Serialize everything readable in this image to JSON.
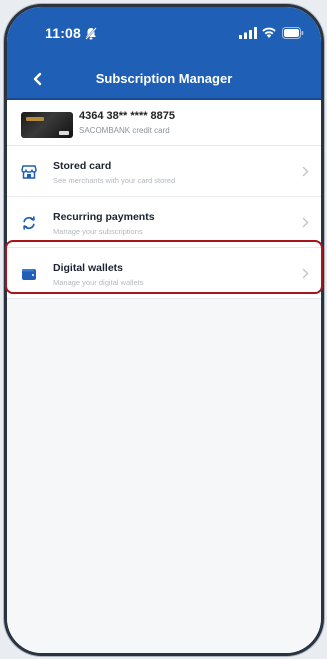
{
  "status_bar": {
    "time": "11:08"
  },
  "nav": {
    "title": "Subscription Manager"
  },
  "card": {
    "number": "4364 38** **** 8875",
    "bank": "SACOMBANK credit card"
  },
  "menu": [
    {
      "label": "Stored card",
      "subtitle": "See merchants with your card stored",
      "icon": "store-icon"
    },
    {
      "label": "Recurring payments",
      "subtitle": "Manage your subscriptions",
      "icon": "refresh-icon"
    },
    {
      "label": "Digital wallets",
      "subtitle": "Manage your digital wallets",
      "icon": "wallet-icon"
    }
  ],
  "colors": {
    "header": "#1f5fb5",
    "highlight": "#a8141c",
    "icon": "#1f5fb5"
  }
}
